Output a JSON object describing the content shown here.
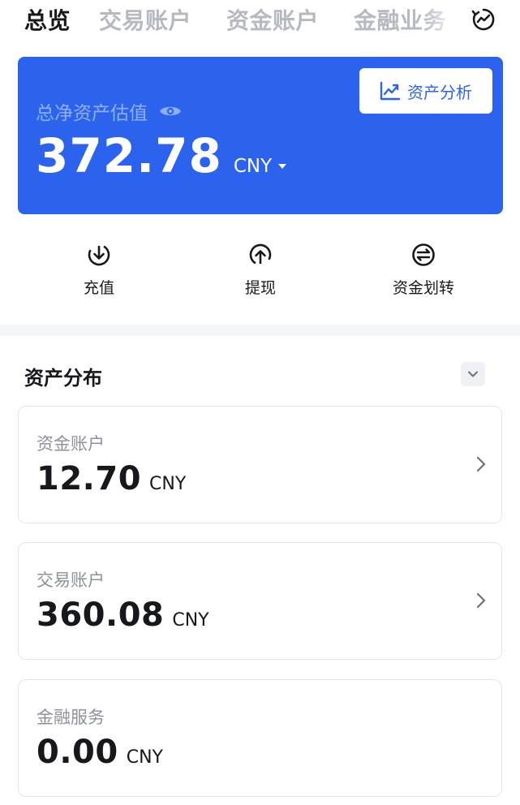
{
  "tabs": [
    {
      "label": "总览",
      "active": true
    },
    {
      "label": "交易账户",
      "active": false
    },
    {
      "label": "资金账户",
      "active": false
    },
    {
      "label": "金融业务",
      "active": false
    }
  ],
  "history_icon": "history-chart-icon",
  "hero": {
    "label": "总净资产估值",
    "eye_icon": "eye-icon",
    "value": "372.78",
    "currency": "CNY",
    "analysis_button": "资产分析",
    "analysis_icon": "trend-chart-icon",
    "bg_color": "#2c63ee"
  },
  "actions": [
    {
      "label": "充值",
      "icon": "download-icon"
    },
    {
      "label": "提现",
      "icon": "upload-icon"
    },
    {
      "label": "资金划转",
      "icon": "transfer-icon"
    }
  ],
  "distribution": {
    "title": "资产分布",
    "collapse_icon": "chevron-down-icon",
    "accounts": [
      {
        "label": "资金账户",
        "value": "12.70",
        "currency": "CNY",
        "has_chevron": true
      },
      {
        "label": "交易账户",
        "value": "360.08",
        "currency": "CNY",
        "has_chevron": true
      },
      {
        "label": "金融服务",
        "value": "0.00",
        "currency": "CNY",
        "has_chevron": false
      }
    ]
  }
}
